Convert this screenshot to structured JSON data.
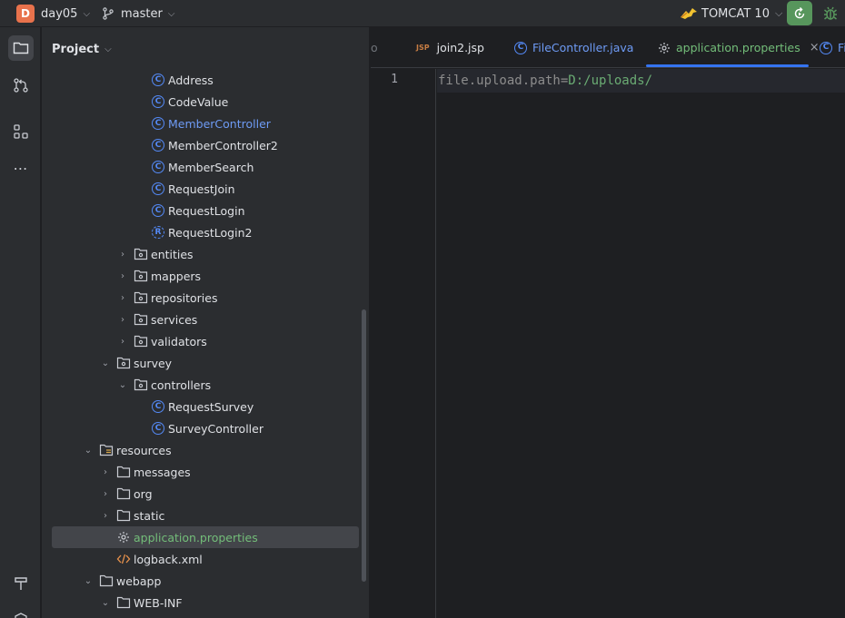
{
  "titlebar": {
    "project_letter": "D",
    "project_name": "day05",
    "branch": "master",
    "run_config": "TOMCAT 10"
  },
  "project_panel": {
    "title": "Project",
    "tree": [
      {
        "label": "Address",
        "type": "class",
        "indent": 3
      },
      {
        "label": "CodeValue",
        "type": "class",
        "indent": 3
      },
      {
        "label": "MemberController",
        "type": "class",
        "indent": 3,
        "color": "blue"
      },
      {
        "label": "MemberController2",
        "type": "class",
        "indent": 3
      },
      {
        "label": "MemberSearch",
        "type": "class",
        "indent": 3
      },
      {
        "label": "RequestJoin",
        "type": "class",
        "indent": 3
      },
      {
        "label": "RequestLogin",
        "type": "class",
        "indent": 3
      },
      {
        "label": "RequestLogin2",
        "type": "record",
        "indent": 3
      },
      {
        "label": "entities",
        "type": "package",
        "indent": 2,
        "arrow": "right"
      },
      {
        "label": "mappers",
        "type": "package",
        "indent": 2,
        "arrow": "right"
      },
      {
        "label": "repositories",
        "type": "package",
        "indent": 2,
        "arrow": "right"
      },
      {
        "label": "services",
        "type": "package",
        "indent": 2,
        "arrow": "right"
      },
      {
        "label": "validators",
        "type": "package",
        "indent": 2,
        "arrow": "right"
      },
      {
        "label": "survey",
        "type": "package",
        "indent": 1,
        "arrow": "down"
      },
      {
        "label": "controllers",
        "type": "package",
        "indent": 2,
        "arrow": "down"
      },
      {
        "label": "RequestSurvey",
        "type": "class",
        "indent": 3
      },
      {
        "label": "SurveyController",
        "type": "class",
        "indent": 3
      },
      {
        "label": "resources",
        "type": "resources",
        "indent": 0,
        "arrow": "down"
      },
      {
        "label": "messages",
        "type": "folder",
        "indent": 1,
        "arrow": "right"
      },
      {
        "label": "org",
        "type": "folder",
        "indent": 1,
        "arrow": "right"
      },
      {
        "label": "static",
        "type": "folder",
        "indent": 1,
        "arrow": "right"
      },
      {
        "label": "application.properties",
        "type": "properties",
        "indent": 1,
        "color": "green",
        "selected": true
      },
      {
        "label": "logback.xml",
        "type": "xml",
        "indent": 1
      },
      {
        "label": "webapp",
        "type": "folder",
        "indent": 0,
        "arrow": "down"
      },
      {
        "label": "WEB-INF",
        "type": "folder",
        "indent": 1,
        "arrow": "down"
      }
    ]
  },
  "tabs": [
    {
      "label": "o",
      "type": "partial"
    },
    {
      "label": "join2.jsp",
      "type": "jsp"
    },
    {
      "label": "FileController.java",
      "type": "class",
      "color": "blue"
    },
    {
      "label": "application.properties",
      "type": "properties",
      "color": "green",
      "active": true
    },
    {
      "label": "Fi",
      "type": "class",
      "color": "blue"
    }
  ],
  "editor": {
    "line_number": "1",
    "key": "file.upload.path",
    "equals": "=",
    "value": "D:/uploads/"
  },
  "colors": {
    "accent": "#3574f0",
    "run_button": "#57965c",
    "class_icon": "#548af7",
    "project_badge": "#e8724c"
  }
}
